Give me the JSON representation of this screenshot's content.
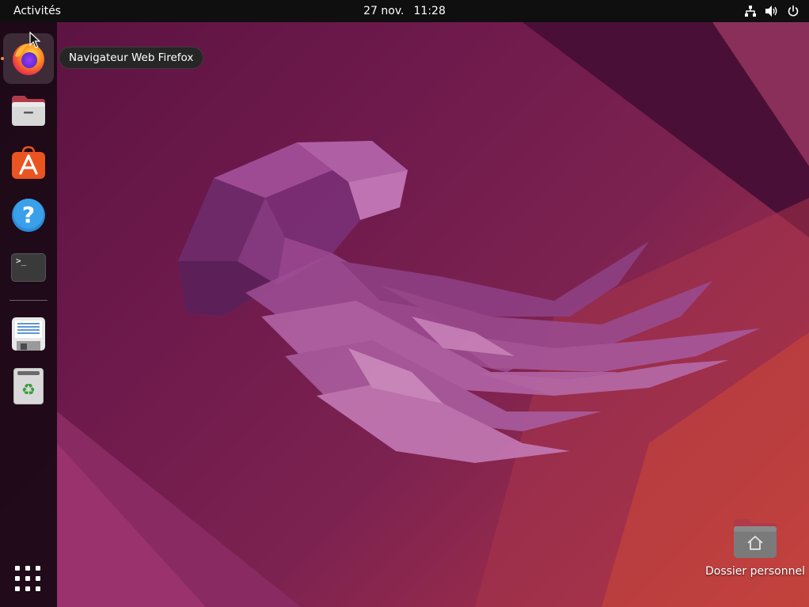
{
  "topbar": {
    "activities_label": "Activités",
    "date": "27 nov.",
    "time": "11:28",
    "icons": [
      "network-icon",
      "volume-icon",
      "power-icon"
    ]
  },
  "dock": {
    "items": [
      {
        "name": "firefox",
        "icon": "firefox-icon",
        "running": true
      },
      {
        "name": "files",
        "icon": "files-folder-icon"
      },
      {
        "name": "software",
        "icon": "app-center-icon"
      },
      {
        "name": "help",
        "icon": "help-icon"
      },
      {
        "name": "terminal",
        "icon": "terminal-icon",
        "glyph": ">_"
      },
      {
        "name": "save-document",
        "icon": "floppy-document-icon"
      },
      {
        "name": "trash",
        "icon": "trash-icon",
        "glyph": "♻"
      }
    ],
    "show_apps_icon": "apps-grid-icon"
  },
  "tooltip": {
    "text": "Navigateur Web Firefox"
  },
  "desktop": {
    "icons": [
      {
        "label": "Dossier personnel",
        "icon": "home-folder-icon"
      }
    ]
  },
  "help_glyph": "?",
  "colors": {
    "topbar": "#0f0f0f",
    "accent_orange": "#e95420",
    "wallpaper_base": "#6e1a4c"
  }
}
